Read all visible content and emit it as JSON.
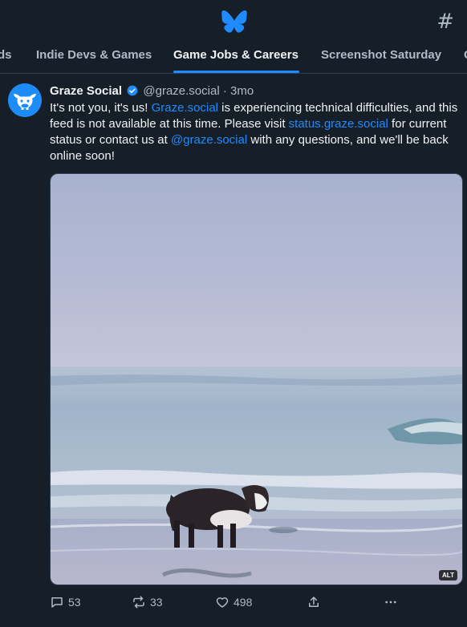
{
  "app": {
    "accent_color": "#208bfe",
    "logo_icon": "butterfly-icon"
  },
  "header": {
    "hash_icon": "#"
  },
  "tabs": [
    {
      "label": "ds",
      "active": false
    },
    {
      "label": "Indie Devs & Games",
      "active": false
    },
    {
      "label": "Game Jobs & Careers",
      "active": true
    },
    {
      "label": "Screenshot Saturday",
      "active": false
    },
    {
      "label": "G",
      "active": false
    }
  ],
  "post": {
    "author": "Graze Social",
    "handle": "@graze.social",
    "separator": "·",
    "time": "3mo",
    "text": {
      "part1": "It's not you, it's us! ",
      "link1": "Graze.social",
      "part2": " is experiencing technical difficulties, and this feed is not available at this time. Please visit ",
      "link2": "status.graze.social",
      "part3": " for current status or contact us at ",
      "link3": "@graze.social",
      "part4": " with any questions, and we'll be back online soon!"
    },
    "media": {
      "alt_badge": "ALT"
    },
    "actions": {
      "replies": "53",
      "reposts": "33",
      "likes": "498"
    }
  }
}
